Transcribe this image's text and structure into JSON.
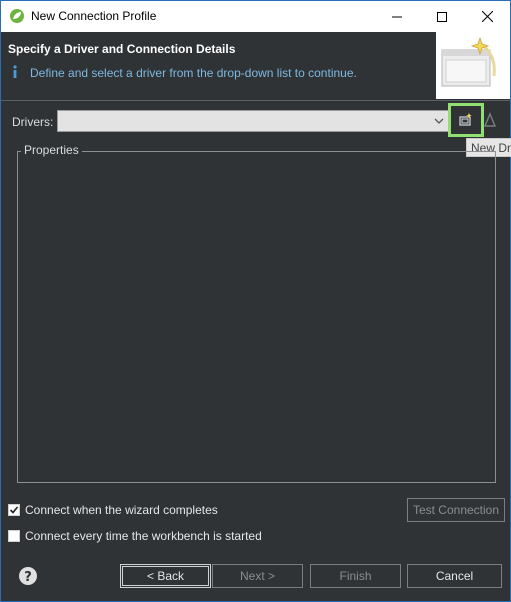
{
  "window": {
    "title": "New Connection Profile"
  },
  "header": {
    "title": "Specify a Driver and Connection Details",
    "description": "Define and select a driver from the drop-down list to continue."
  },
  "drivers": {
    "label": "Drivers:",
    "value": "",
    "tooltip": "New Dr"
  },
  "properties": {
    "legend": "Properties"
  },
  "options": {
    "connect_on_complete": {
      "label": "Connect when the wizard completes",
      "checked": true
    },
    "connect_on_start": {
      "label": "Connect every time the workbench is started",
      "checked": false
    }
  },
  "buttons": {
    "test_connection": "Test Connection",
    "back": "< Back",
    "next": "Next >",
    "finish": "Finish",
    "cancel": "Cancel"
  },
  "colors": {
    "background": "#2f3336",
    "highlight": "#8fe070",
    "info_text": "#7fb8e0"
  }
}
